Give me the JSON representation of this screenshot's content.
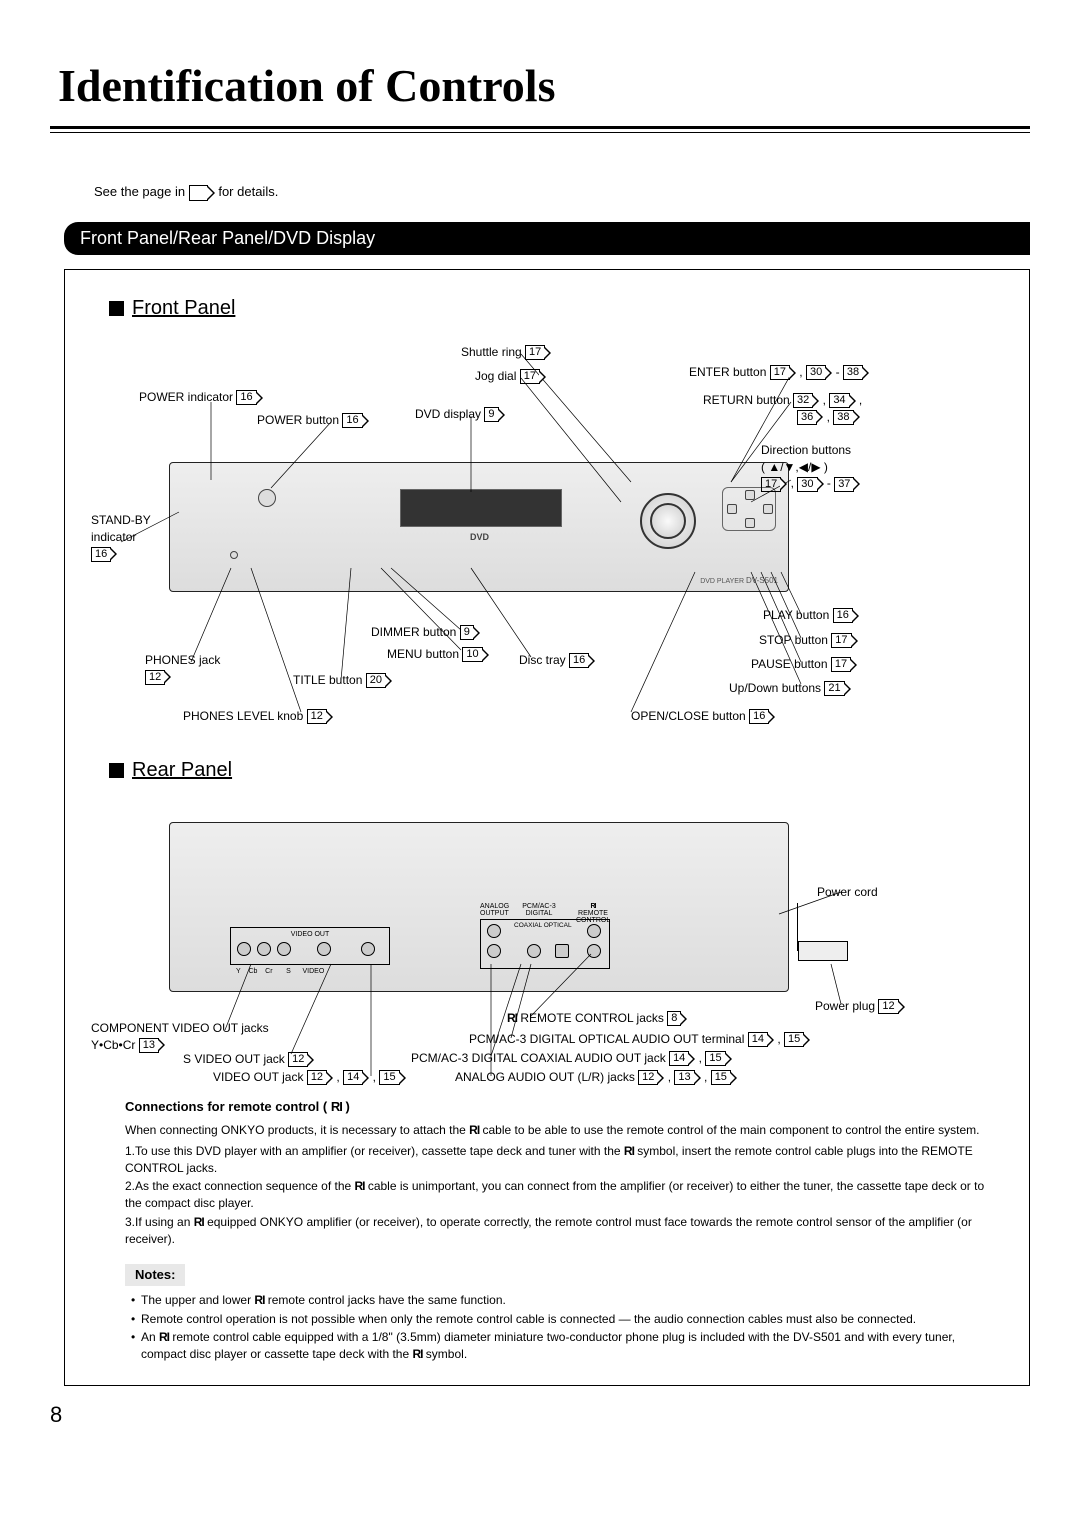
{
  "page_title": "Identification of Controls",
  "intro_pre": "See the page in ",
  "intro_post": " for details.",
  "section": "Front Panel/Rear Panel/DVD Display",
  "front_heading": "Front Panel",
  "rear_heading": "Rear Panel",
  "model": "DV-S501",
  "front": {
    "power_indicator": {
      "label": "POWER indicator",
      "refs": [
        "16"
      ]
    },
    "power_button": {
      "label": "POWER button",
      "refs": [
        "16"
      ]
    },
    "dvd_display": {
      "label": "DVD display",
      "refs": [
        "9"
      ]
    },
    "shuttle_ring": {
      "label": "Shuttle ring",
      "refs": [
        "17"
      ]
    },
    "jog_dial": {
      "label": "Jog dial",
      "refs": [
        "17"
      ]
    },
    "enter_button": {
      "label": "ENTER button",
      "refs": [
        "17",
        "30",
        "38"
      ],
      "range": true
    },
    "return_button": {
      "label": "RETURN button",
      "refs": [
        "32",
        "34",
        "36",
        "38"
      ]
    },
    "direction_buttons": {
      "label": "Direction buttons",
      "sub": "( ▲/▼,◀/▶ )",
      "refs": [
        "17",
        "30",
        "37"
      ],
      "range": true
    },
    "standby": {
      "label": "STAND-BY indicator",
      "refs": [
        "16"
      ]
    },
    "play": {
      "label": "PLAY button",
      "refs": [
        "16"
      ]
    },
    "stop": {
      "label": "STOP button",
      "refs": [
        "17"
      ]
    },
    "pause": {
      "label": "PAUSE button",
      "refs": [
        "17"
      ]
    },
    "updown": {
      "label": "Up/Down buttons",
      "refs": [
        "21"
      ]
    },
    "openclose": {
      "label": "OPEN/CLOSE button",
      "refs": [
        "16"
      ]
    },
    "disc_tray": {
      "label": "Disc tray",
      "refs": [
        "16"
      ]
    },
    "dimmer": {
      "label": "DIMMER button",
      "refs": [
        "9"
      ]
    },
    "menu": {
      "label": "MENU button",
      "refs": [
        "10"
      ]
    },
    "title": {
      "label": "TITLE button",
      "refs": [
        "20"
      ]
    },
    "phones": {
      "label": "PHONES jack",
      "refs": [
        "12"
      ]
    },
    "phones_level": {
      "label": "PHONES LEVEL knob",
      "refs": [
        "12"
      ]
    }
  },
  "rear": {
    "power_cord": {
      "label": "Power cord"
    },
    "power_plug": {
      "label": "Power plug",
      "refs": [
        "12"
      ]
    },
    "ri_remote": {
      "pre": "",
      "sym": "RI",
      "label": " REMOTE CONTROL jacks",
      "refs": [
        "8"
      ]
    },
    "component": {
      "label": "COMPONENT VIDEO OUT jacks",
      "sub": "Y•Cb•Cr",
      "refs": [
        "13"
      ]
    },
    "svideo": {
      "label": "S VIDEO OUT jack",
      "refs": [
        "12"
      ]
    },
    "video": {
      "label": "VIDEO OUT jack",
      "refs": [
        "12",
        "14",
        "15"
      ]
    },
    "optical": {
      "label": "PCM/AC-3 DIGITAL OPTICAL AUDIO OUT terminal",
      "refs": [
        "14",
        "15"
      ]
    },
    "coax": {
      "label": "PCM/AC-3 DIGITAL COAXIAL AUDIO OUT jack",
      "refs": [
        "14",
        "15"
      ]
    },
    "analog": {
      "label": "ANALOG AUDIO OUT  (L/R) jacks",
      "refs": [
        "12",
        "13",
        "15"
      ]
    },
    "panel_labels": {
      "video_out": "VIDEO OUT",
      "analog_output": "ANALOG\nOUTPUT",
      "pcm": "PCM/AC-3\nDIGITAL",
      "ri": "REMOTE\nCONTROL",
      "coax_opt": "COAXIAL  OPTICAL",
      "ycbcr": "Y    Cb    Cr",
      "svideo": "S    VIDEO"
    }
  },
  "connections_heading": "Connections for remote control ( ",
  "connections_heading_end": " )",
  "conn_intro": "When connecting ONKYO products, it is necessary to attach the ",
  "conn_intro2": " cable to be able to use the remote control of the main component to control the entire system.",
  "steps": [
    {
      "n": "1.",
      "a": "To use this DVD player with an amplifier (or receiver), cassette tape deck and tuner with the ",
      "b": " symbol, insert the remote control cable plugs into the REMOTE CONTROL jacks."
    },
    {
      "n": "2.",
      "a": "As the exact connection sequence of the ",
      "b": " cable is unimportant, you can connect from the amplifier (or receiver) to either the tuner, the cassette tape deck or to the compact disc player."
    },
    {
      "n": "3.",
      "a": "If using an ",
      "b": " equipped ONKYO amplifier (or receiver), to operate correctly, the remote control must face towards the remote control sensor of the amplifier (or receiver)."
    }
  ],
  "notes_heading": "Notes:",
  "notes": [
    {
      "a": "The upper and lower ",
      "b": " remote control jacks have the same function."
    },
    {
      "a": "Remote control operation is not possible when only the remote control cable is connected — the audio connection cables must also be connected.",
      "plain": true
    },
    {
      "a": "An ",
      "b": " remote control cable equipped with a 1/8\" (3.5mm) diameter miniature two-conductor phone plug is included with the DV-S501 and with every tuner, compact disc player or cassette tape deck with the ",
      "c": " symbol."
    }
  ],
  "page_number": "8",
  "ri_symbol": "RI"
}
